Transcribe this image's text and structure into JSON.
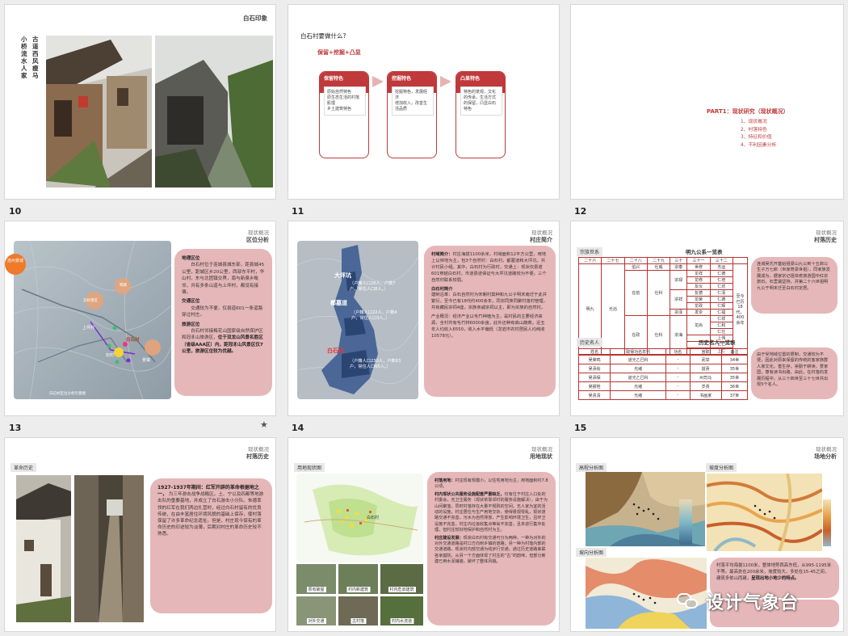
{
  "slides": {
    "s1": {
      "title": "白石印象",
      "poem": [
        "小桥流水人家",
        "古道西风瘦马"
      ]
    },
    "s2": {
      "question": "白石村要做什么?",
      "slogan": "保留+挖掘+凸显",
      "cards": [
        {
          "title": "保留特色",
          "items": [
            "原始自然特色",
            "原生态生活的村落肌理",
            "乡土建筑特色"
          ]
        },
        {
          "title": "挖掘特色",
          "items": [
            "挖掘特色，发展经济",
            "增加收入，改善生活品质"
          ]
        },
        {
          "title": "凸显特色",
          "items": [
            "特色的景观，文化的传承，生活方式的保留，凸显白石特色"
          ]
        }
      ]
    },
    "s3": {
      "part": "PART1：现状研究（现状概况）",
      "items": [
        "1、现状概况",
        "2、村落特色",
        "3、特征和价值",
        "4、不利因素分析"
      ]
    },
    "s10": {
      "num": "10",
      "tag_top": "现状概况",
      "tag": "区位分析",
      "map_label_left": "连州景城",
      "map_labels": [
        "萌路",
        "云岭景区",
        "上坪村",
        "白石村",
        "石村",
        "景镇"
      ],
      "map_scale": "白石村区位分析示意图",
      "h1": "地理区位",
      "p1": "白石村位于连城县城东部，距县城45公里，距城区乡20公里，西部东平村，华山村，东与北团镇交界，南与新泉乡毗邻，共有多条山道与上坪村，都没有接壤。",
      "h2": "交通区位",
      "p2": "交通较为不便，仅县道601一条道路穿过村庄。",
      "h3": "旅游区位",
      "p3a": "白石村邻接梅花山国家级自然保护区和冠豸山旅游区，",
      "p3b": "位于双龙山风景名胜区（省级AAA区）内，距冠豸山风景区仅7公里，旅游区位较为优越。"
    },
    "s11": {
      "num": "11",
      "tag_top": "现状概况",
      "tag": "村庄简介",
      "places": [
        {
          "name": "大坪坑",
          "info": "（户籍人口26人，户数7户，常住人口8人。）"
        },
        {
          "name": "都墓道",
          "info": "（户籍人口22人，户数4户，常住人口3人。）"
        },
        {
          "name": "白石坑",
          "info": "（户籍人口230人，户数63户，常住人口65人。）"
        }
      ],
      "h1": "村域简介：",
      "p1": "村庄海拔1100余米，村域面积12平方公里，用地上以林地为主，包3个自然村：白石村，都墓道和大坪坑，共计村民小组。其中，白石村为行政村，交通上：现状仅县道601穿越白石村，市道县道保证与大坪坑道路较为不便，三个自然村联系较弱。",
      "h2": "白石村简介",
      "p2": "建制沿革：白石自然村为宋朝村莫种和九公子明末南迁于此并繁衍，至今已有18代约400余年，同宗同族同聚村落村管理，共有藏民宗祠4座，宗族亲戚宗祠以主，即为宗族的自然村。",
      "p3": "产业概况：经济产业以毛竹种植为主，是村民的主要经济来源，全村共有毛竹林6000余亩，此外还种有高山蔬菜。近五年人均收入6550，收入水平偏低（龙岩市农村居民人均纯收10578元）。"
    },
    "s12": {
      "num": "12",
      "tag_top": "现状概况",
      "tag": "村落历史",
      "label1": "宗族世系",
      "table1_title": "明九公系一览表",
      "gens": [
        "二十六",
        "二十七",
        "二十八",
        "二十九",
        "三十",
        "三十一",
        "三十二"
      ],
      "root": "明九",
      "g27": "光滔",
      "g28a": "伯兴",
      "g28b": "在前",
      "g28c": "在政",
      "g29a": "仕威",
      "g29b": "仕科",
      "g29c": "仕科",
      "g30": [
        "宗泰",
        "宗禄",
        "宗祥",
        "宗泽",
        "宗海"
      ],
      "g31": [
        "世修",
        "龙祥",
        "龙修",
        "友仪",
        "友德",
        "龙荣",
        "龙政",
        "发崇",
        "龙尚"
      ],
      "g32": [
        "杰运",
        "仁德",
        "仁培",
        "仁坊",
        "仁清",
        "仁德",
        "仁辉",
        "仁福",
        "仁祥",
        "仁和",
        "仁仕",
        "上伟",
        "仁仁",
        "上仁"
      ],
      "span_note": "至今已历18代，400余年",
      "box1": "连城吴氏开基始祖梁山九公到十五郎公生子万七郎（世家脊梁世祖），同家族发展成为，据家宗记祖体奇旅游国中红宗旅石，石里最坚持，并第二十六世祖明九公于明末迁至白石村定居。",
      "label2": "历史名人",
      "table2_title": "历史名人一览表",
      "t2_head": [
        "姓名",
        "取得功名年代",
        "功名",
        "官职",
        "备注"
      ],
      "t2_rows": [
        [
          "吴荣鸣",
          "道光乙巳科",
          "-",
          "武举",
          "34世"
        ],
        [
          "吴添侩",
          "光绪",
          "-",
          "拔贡",
          "35世"
        ],
        [
          "吴添保",
          "道光乙巳科",
          "-",
          "州司马",
          "35世"
        ],
        [
          "吴擢桂",
          "光绪",
          "-",
          "岁贡",
          "36世"
        ],
        [
          "吴贵清",
          "光绪",
          "-",
          "书画家",
          "37世"
        ]
      ],
      "box2": "由于受地域位置的限制，交通较为不便，因此对原来保留的传统的客家族群人家文化，善生存，崇勤于耕读，爱家国，尊有读书出路，由此，在村落的发展历程中，从三十四世至三十七世共出现5个名人。"
    },
    "s13": {
      "num": "13",
      "tag_top": "现状概况",
      "tag": "村落历史",
      "label": "革命历史",
      "title": "1927-1937年期间：红军开辟的革命根据地之一，",
      "text": "为三年游击战争战略区。土、宁以及四都等地游击队的重要基地，并成立了白石游击小分队。朱德率领的红军在我们两边扎营时，经过白石村留有的优良传统，在由丰富居住环境风貌的基础上保存，使村落保留了许多革命纪念遗址。但是，村庄现今保有的革命历史的印迹较为淡薄，后期对村庄的革命历史较不熟悉。"
    },
    "s14": {
      "num": "14",
      "tag_top": "现状概况",
      "tag": "用地现状",
      "label": "用地现状图",
      "map_center": "白石村",
      "photos": [
        "原有破屋",
        "村内新建筑",
        "村内危旧建筑",
        "对外交通",
        "古村落",
        "村内水流道"
      ],
      "h1": "村落用地：",
      "p1": "村庄现有规模小，以住宅用地为主，用地面积约7.8公顷。",
      "h2": "村内现状公共服务设施配套严重缺乏，",
      "p2": "仅有位于村庄入口处的村委会，无卫生服务（现状依靠邻村的服务设施解决），由于为山间聚落，同时村落存在大量不规则的空间，无人家为宜的活动的设施，村庄居住与生产用地交杂，使得景观零乱，现状道路交通不完善，污水为自然排放，产生影响环境卫生，且环卫设施不完善，村庄内垃圾收集点等尚不完善，且未进行集中处理，但村庄较好地保护和自然村为主。",
      "h3": "村庄建设发展：",
      "p3": "现状白石村有交通可分为两种，一种为对外的对外交通道路是村口方向到乡镇的道路；另一种为村落内部的交通道路，现状村内部交通为线步行交通，通过历史道路串联各家庭院，从另一个方面体现了村庄的“古”的韵味，但部分新建已用水泥铺装，破坏了整体风貌。"
    },
    "s15": {
      "num": "15",
      "tag_top": "现状概况",
      "tag": "场地分析",
      "label1": "高程分析图",
      "label2": "坡度分析图",
      "label3": "坡向分析图",
      "text_a": "村落平均海拔1100米，整体地势西高东低，从995-1195米不等。最高处在200余米，坡度较大，多处在15-45之间，建筑多依山而建，",
      "text_b": "呈现出地小地少的特点。"
    },
    "watermark": "设计气象台"
  },
  "colors": {
    "accent": "#c0393b",
    "pink": "#e6b7b8",
    "orange": "#ee7a2a"
  }
}
